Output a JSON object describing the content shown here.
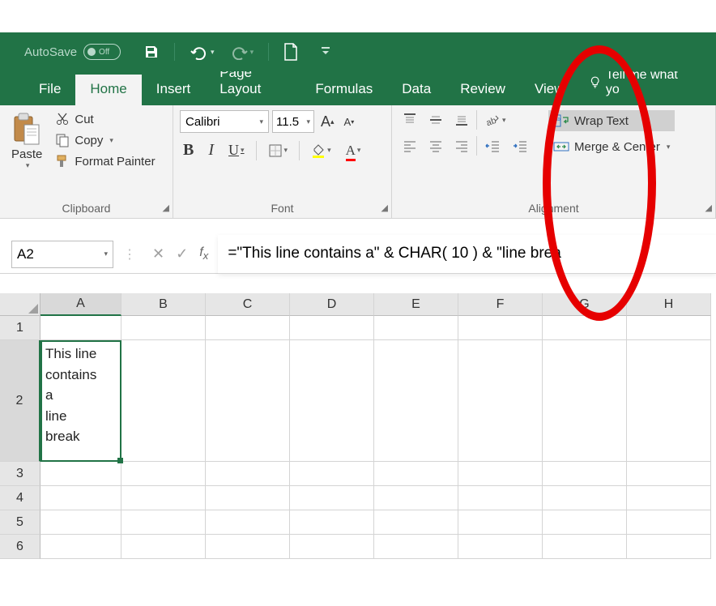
{
  "titlebar": {
    "autosave_label": "AutoSave",
    "autosave_state": "Off"
  },
  "tabs": {
    "file": "File",
    "home": "Home",
    "insert": "Insert",
    "pagelayout": "Page Layout",
    "formulas": "Formulas",
    "data": "Data",
    "review": "Review",
    "view": "View",
    "tellme": "Tell me what yo"
  },
  "ribbon": {
    "clipboard": {
      "paste": "Paste",
      "cut": "Cut",
      "copy": "Copy",
      "format_painter": "Format Painter",
      "group_label": "Clipboard"
    },
    "font": {
      "name": "Calibri",
      "size": "11.5",
      "group_label": "Font"
    },
    "alignment": {
      "wrap_text": "Wrap Text",
      "merge_center": "Merge & Center",
      "group_label": "Alignment"
    }
  },
  "namebox": "A2",
  "formula": "=\"This line contains a\" & CHAR( 10 ) & \"line brea",
  "columns": [
    "A",
    "B",
    "C",
    "D",
    "E",
    "F",
    "G",
    "H"
  ],
  "rows": [
    "1",
    "2",
    "3",
    "4",
    "5",
    "6"
  ],
  "cells": {
    "A2": "This line\ncontains\na\nline\nbreak"
  }
}
